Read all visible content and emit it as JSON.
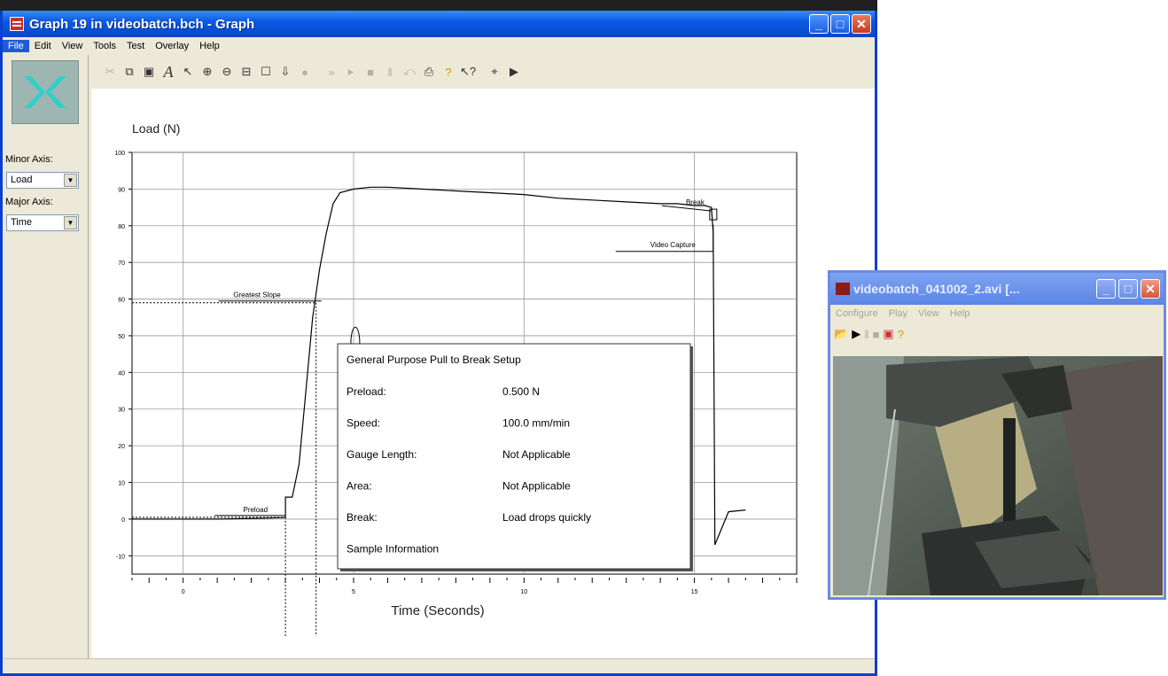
{
  "main_window": {
    "title": "Graph 19 in videobatch.bch - Graph",
    "menu": [
      "File",
      "Edit",
      "View",
      "Tools",
      "Test",
      "Overlay",
      "Help"
    ],
    "sidebar": {
      "minor_axis_label": "Minor Axis:",
      "minor_axis_value": "Load",
      "major_axis_label": "Major Axis:",
      "major_axis_value": "Time"
    }
  },
  "chart_data": {
    "type": "line",
    "ylabel": "Load (N)",
    "xlabel": "Time (Seconds)",
    "xlim": [
      -1.5,
      18
    ],
    "ylim": [
      -15,
      100
    ],
    "yticks": [
      -10,
      0,
      10,
      20,
      30,
      40,
      50,
      60,
      70,
      80,
      90,
      100
    ],
    "xticks": [
      0,
      5,
      10,
      15
    ],
    "grid": true,
    "series": [
      {
        "x": [
          -1.5,
          0,
          1,
          2,
          2.5,
          2.9,
          3.0,
          3.0,
          3.2,
          3.4,
          3.6,
          3.8,
          4.0,
          4.2,
          4.4,
          4.6,
          5.0,
          5.5,
          6.0,
          7.0,
          8.0,
          9.0,
          10.0,
          11.0,
          12.0,
          13.0,
          14.0,
          14.5,
          15.0,
          15.3,
          15.5,
          15.55,
          15.6,
          16.0,
          16.5
        ],
        "y": [
          0,
          0,
          0,
          0.2,
          0.3,
          0.4,
          0.5,
          6,
          6,
          15,
          35,
          55,
          68,
          78,
          86,
          89,
          90,
          90.5,
          90.5,
          90,
          89.5,
          89,
          88.5,
          87.5,
          87,
          86.5,
          86,
          86,
          85.5,
          85.5,
          85,
          78,
          -7,
          2,
          2.5
        ]
      }
    ],
    "annotations": [
      {
        "label": "Preload",
        "x": 3.0,
        "y": 0.5
      },
      {
        "label": "Greatest Slope",
        "x": 3.9,
        "y": 59
      },
      {
        "label": "Break",
        "x": 15.5,
        "y": 85
      },
      {
        "label": "Video Capture",
        "x": 15.55,
        "y": 73
      }
    ],
    "info_box": {
      "title": "General Purpose Pull to Break Setup",
      "rows": [
        {
          "label": "Preload:",
          "value": "0.500 N"
        },
        {
          "label": "Speed:",
          "value": "100.0 mm/min"
        },
        {
          "label": "Gauge Length:",
          "value": "Not Applicable"
        },
        {
          "label": "Area:",
          "value": "Not Applicable"
        },
        {
          "label": "Break:",
          "value": "Load drops quickly"
        },
        {
          "label": "Sample Information",
          "value": ""
        }
      ]
    }
  },
  "video_window": {
    "title": "videobatch_041002_2.avi [...",
    "menu": [
      "Configure",
      "Play",
      "View",
      "Help"
    ]
  }
}
